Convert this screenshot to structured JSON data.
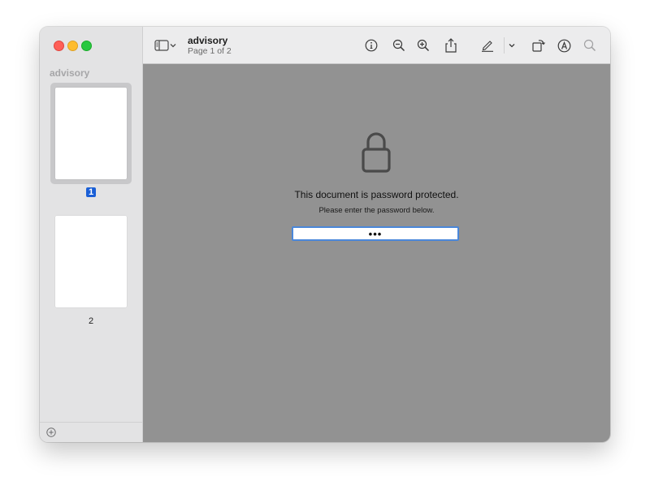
{
  "window": {
    "title": "advisory",
    "subtitle": "Page 1 of 2"
  },
  "sidebar": {
    "title": "advisory",
    "pages": [
      {
        "label": "1",
        "selected": true
      },
      {
        "label": "2",
        "selected": false
      }
    ],
    "footer_icon": "add-circle-icon"
  },
  "toolbar": {
    "icons": [
      "sidebar-toggle-icon",
      "chevron-down-icon",
      "info-icon",
      "zoom-out-icon",
      "zoom-in-icon",
      "share-icon",
      "markup-pen-icon",
      "chevron-down-icon",
      "rotate-icon",
      "annotate-icon",
      "search-icon"
    ]
  },
  "content": {
    "lock_icon": "lock-icon",
    "message": "This document is password protected.",
    "instruction": "Please enter the password below.",
    "password_value": "•••"
  },
  "colors": {
    "content_bg": "#929292",
    "sidebar_bg": "#e3e3e4",
    "selection": "#1a5fd6",
    "input_focus": "#4a87da",
    "close": "#fe5f57",
    "minimize": "#febc2e",
    "maximize": "#28c840"
  }
}
